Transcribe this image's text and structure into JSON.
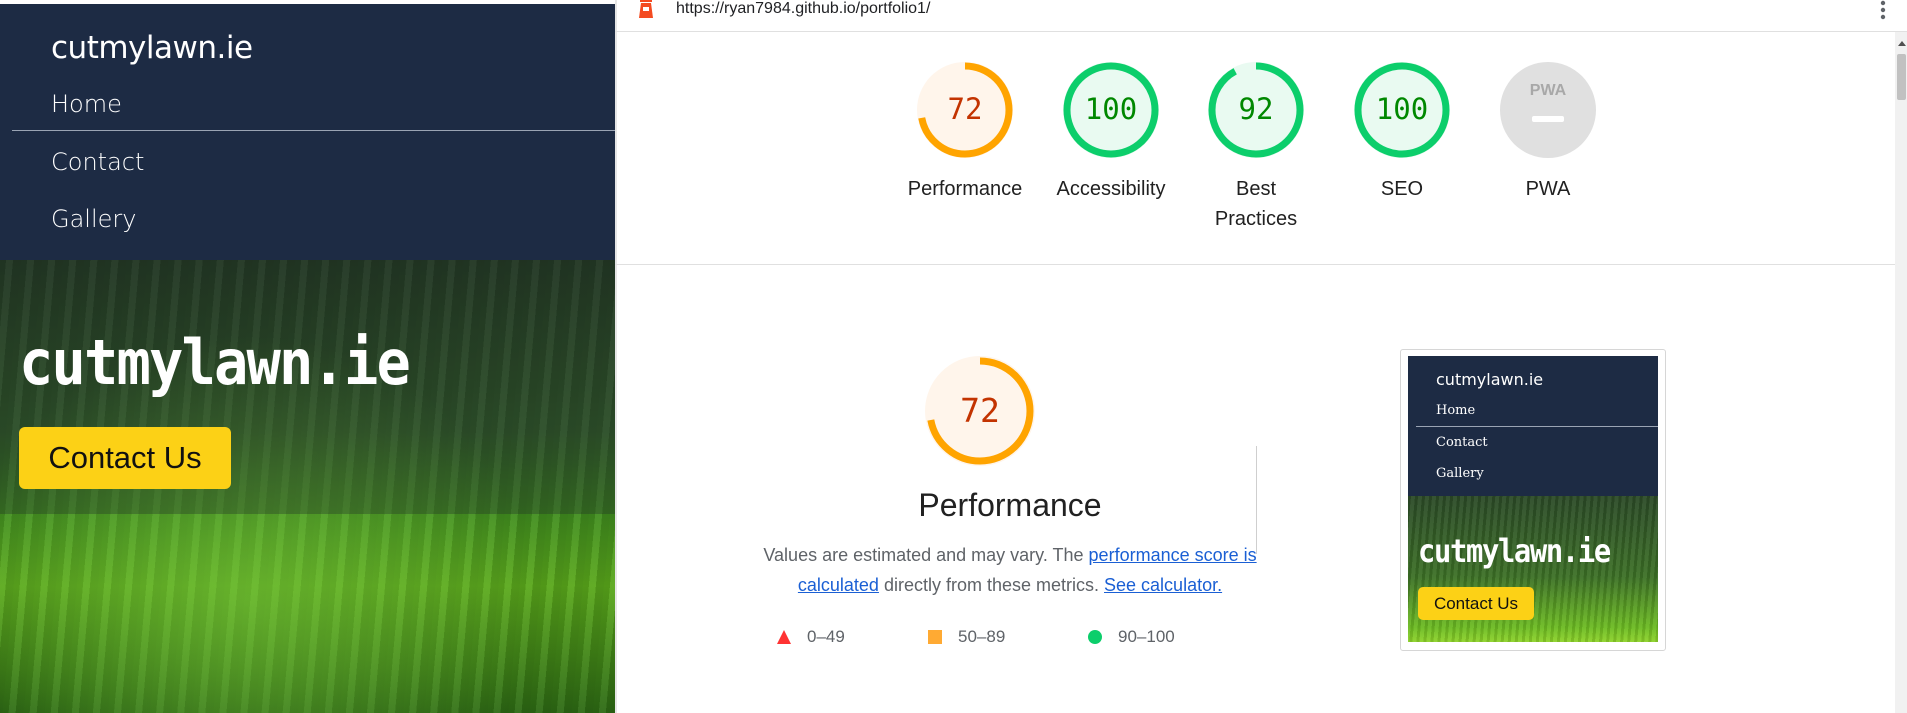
{
  "site": {
    "brand": "cutmylawn.ie",
    "nav": [
      {
        "label": "Home"
      },
      {
        "label": "Contact"
      },
      {
        "label": "Gallery"
      }
    ],
    "hero": {
      "title": "cutmylawn.ie",
      "button": "Contact Us"
    }
  },
  "browser": {
    "url": "https://ryan7984.github.io/portfolio1/"
  },
  "report": {
    "colors": {
      "orange": "#ffa400",
      "green": "#0cce6b",
      "red_text": "#c33300",
      "green_text": "#008800",
      "grey": "#cccccc"
    },
    "categories": [
      {
        "label": "Performance",
        "score": "72",
        "fraction": 0.72,
        "rating": "average"
      },
      {
        "label": "Accessibility",
        "score": "100",
        "fraction": 1.0,
        "rating": "pass"
      },
      {
        "label": "Best Practices",
        "score": "92",
        "fraction": 0.92,
        "rating": "pass"
      },
      {
        "label": "SEO",
        "score": "100",
        "fraction": 1.0,
        "rating": "pass"
      },
      {
        "label": "PWA",
        "score": "",
        "fraction": 0,
        "rating": "na",
        "badge": "PWA"
      }
    ],
    "performance": {
      "score": "72",
      "fraction": 0.72,
      "title": "Performance",
      "desc_prefix": "Values are estimated and may vary. The ",
      "desc_link": "performance score is calculated",
      "desc_middle": " directly from these metrics. ",
      "desc_link2": "See calculator.",
      "legend": [
        {
          "shape": "triangle",
          "range": "0–49",
          "color": "#ff3333"
        },
        {
          "shape": "square",
          "range": "50–89",
          "color": "#ffaa33"
        },
        {
          "shape": "circle",
          "range": "90–100",
          "color": "#0cce6b"
        }
      ]
    },
    "thumbnail": {
      "brand": "cutmylawn.ie",
      "nav": [
        "Home",
        "Contact",
        "Gallery"
      ],
      "hero_title": "cutmylawn.ie",
      "button": "Contact Us"
    }
  }
}
